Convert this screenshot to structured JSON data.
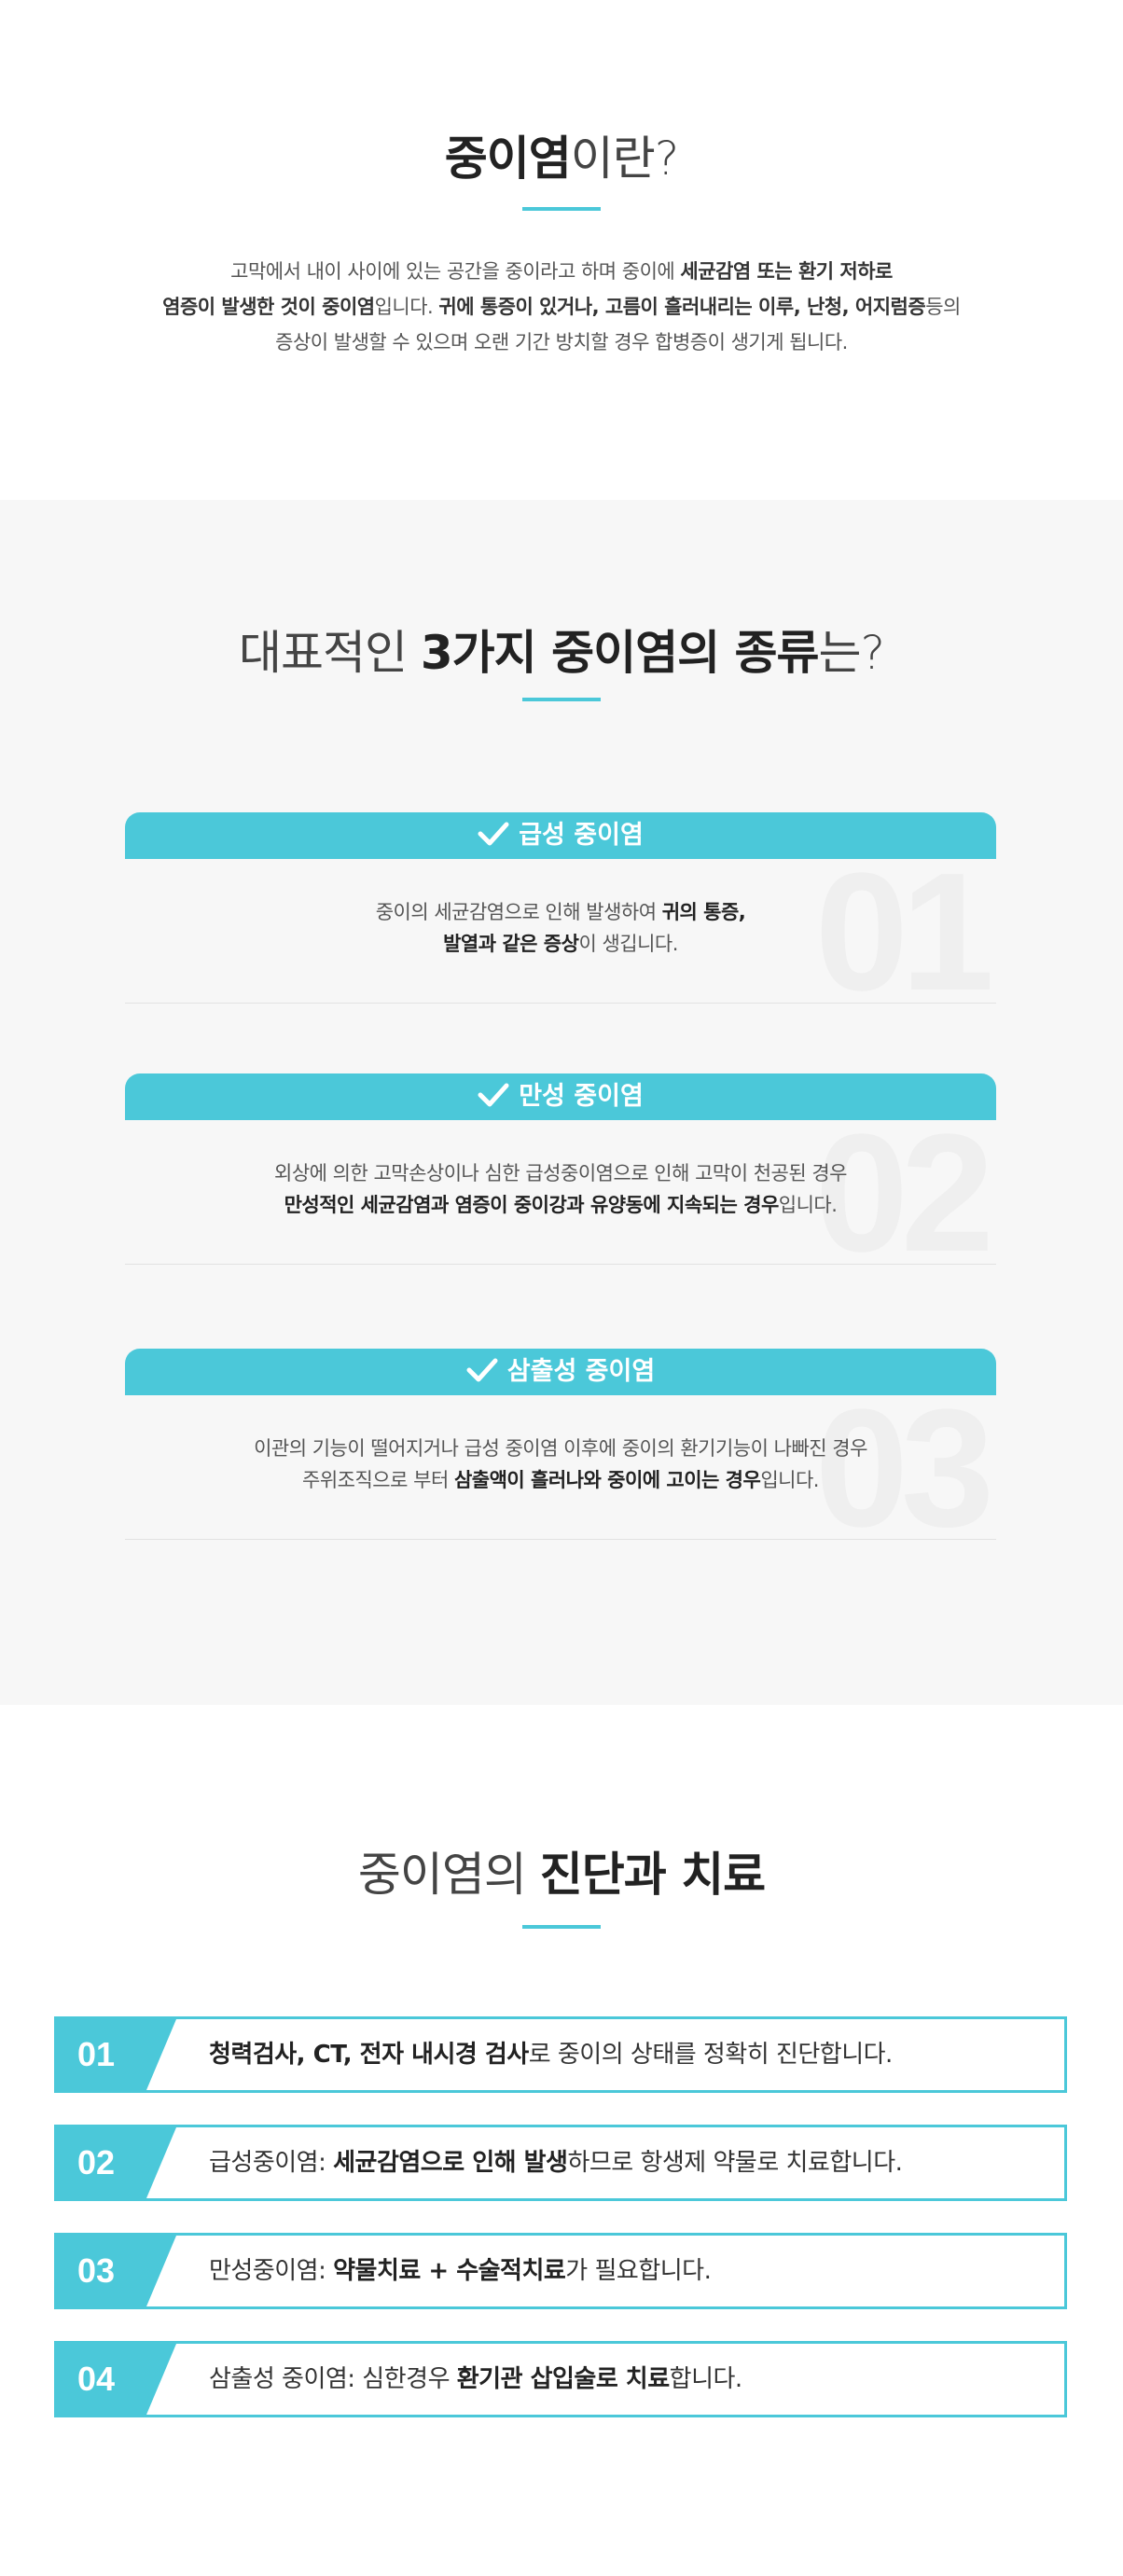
{
  "intro": {
    "title_bold": "중이염",
    "title_light": "이란?",
    "line1_a": "고막에서 내이 사이에 있는 공간을 중이라고 하며 중이에 ",
    "line1_b": "세균감염 또는 환기 저하로",
    "line2_a": "염증이 발생한 것이 중이염",
    "line2_b": "입니다. ",
    "line2_c": "귀에 통증이 있거나, 고름이 흘러내리는 이루, 난청, 어지럼증",
    "line2_d": "등의",
    "line3": "증상이 발생할 수 있으며 오랜 기간 방치할 경우 합병증이 생기게 됩니다."
  },
  "types": {
    "title_light1": "대표적인 ",
    "title_bold": "3가지 중이염의 종류",
    "title_light2": "는?",
    "cards": [
      {
        "label": "급성 중이염",
        "num": "01",
        "l1_a": "중이의 세균감염으로 인해 발생하여 ",
        "l1_b": "귀의 통증,",
        "l2_a": "발열과 같은 증상",
        "l2_b": "이 생깁니다."
      },
      {
        "label": "만성 중이염",
        "num": "02",
        "l1_a": "외상에 의한 고막손상이나 심한 급성중이염으로 인해 고막이 천공된 경우",
        "l2_a": "만성적인 세균감염과 염증이 중이강과 유양동에 지속되는 경우",
        "l2_b": "입니다."
      },
      {
        "label": "삼출성 중이염",
        "num": "03",
        "l1_a": "이관의 기능이 떨어지거나 급성 중이염 이후에 중이의 환기기능이 나빠진 경우",
        "l2_a": "주위조직으로 부터 ",
        "l2_b": "삼출액이 흘러나와 중이에 고이는 경우",
        "l2_c": "입니다."
      }
    ]
  },
  "treatment": {
    "title_light": "중이염의 ",
    "title_bold": "진단과 치료",
    "rows": [
      {
        "num": "01",
        "a": "",
        "b": "청력검사, CT, 전자 내시경 검사",
        "c": "로 중이의 상태를 정확히 진단합니다."
      },
      {
        "num": "02",
        "a": "급성중이염: ",
        "b": "세균감염으로 인해 발생",
        "c": "하므로 항생제 약물로 치료합니다."
      },
      {
        "num": "03",
        "a": "만성중이염: ",
        "b": "약물치료 + 수술적치료",
        "c": "가 필요합니다."
      },
      {
        "num": "04",
        "a": "삼출성 중이염: 심한경우 ",
        "b": "환기관 삽입술로 치료",
        "c": "합니다."
      }
    ]
  },
  "colors": {
    "accent": "#4bc8d9",
    "gray_bg": "#f7f7f7"
  }
}
